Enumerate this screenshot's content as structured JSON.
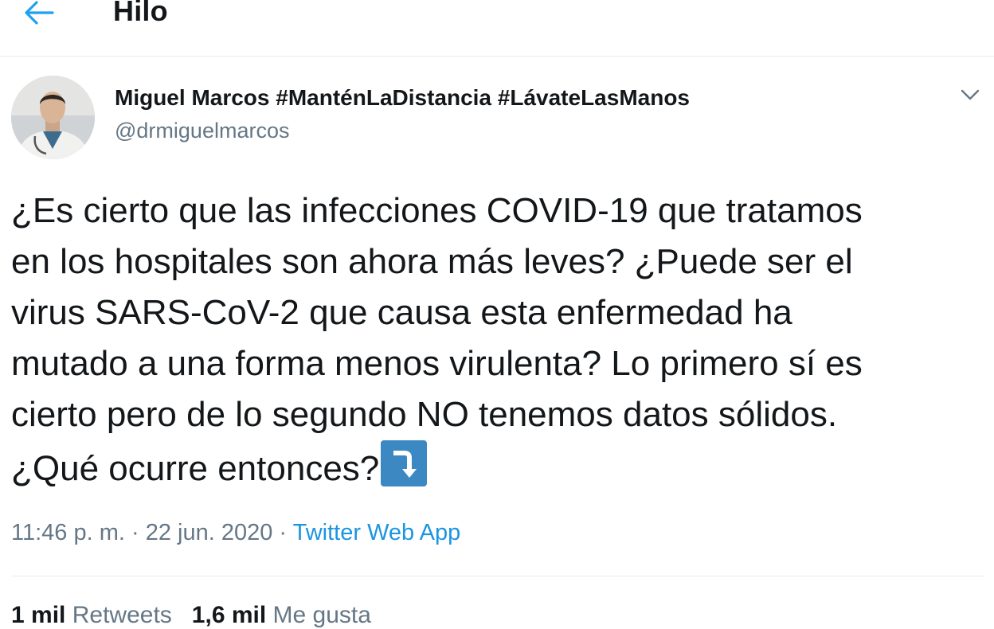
{
  "header": {
    "title": "Hilo",
    "back_icon": "arrow-left-icon",
    "accent_color": "#1da1f2"
  },
  "tweet": {
    "author_name": "Miguel Marcos #ManténLaDistancia #LávateLasManos",
    "author_handle": "@drmiguelmarcos",
    "menu_icon": "chevron-down-icon",
    "text": "¿Es cierto que las infecciones COVID-19 que tratamos\nen los hospitales son ahora más leves? ¿Puede ser el\nvirus SARS-CoV-2 que causa esta enfermedad ha\nmutado a una forma menos virulenta? Lo primero sí es\ncierto pero de lo segundo NO tenemos datos sólidos.\n¿Qué ocurre entonces?",
    "emoji_icon": "arrow-curving-down-icon",
    "time": "11:46 p. m.",
    "date": "22 jun. 2020",
    "source": "Twitter Web App",
    "separator": " · ",
    "stats": {
      "retweets_count": "1 mil",
      "retweets_label": "Retweets",
      "likes_count": "1,6 mil",
      "likes_label": "Me gusta"
    }
  },
  "colors": {
    "text": "#14171a",
    "secondary_text": "#657786",
    "link": "#1b95e0",
    "divider": "#e6ecf0",
    "emoji_bg": "#3b88c3"
  }
}
